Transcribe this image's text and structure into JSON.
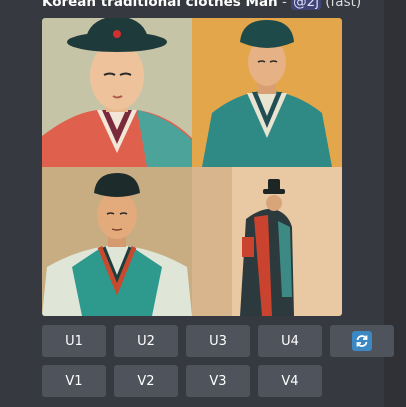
{
  "message": {
    "prompt": "Korean traditional clothes Man",
    "separator": " - ",
    "mention": "@2j",
    "mode": "(fast)"
  },
  "images": [
    {
      "name": "image-1"
    },
    {
      "name": "image-2"
    },
    {
      "name": "image-3"
    },
    {
      "name": "image-4"
    }
  ],
  "buttons": {
    "upscale": [
      "U1",
      "U2",
      "U3",
      "U4"
    ],
    "variation": [
      "V1",
      "V2",
      "V3",
      "V4"
    ],
    "reroll_icon": "refresh-icon"
  },
  "colors": {
    "background": "#36393f",
    "button": "#4f545c",
    "reroll_accent": "#3b88c3",
    "mention_bg": "#3e4a7a"
  }
}
